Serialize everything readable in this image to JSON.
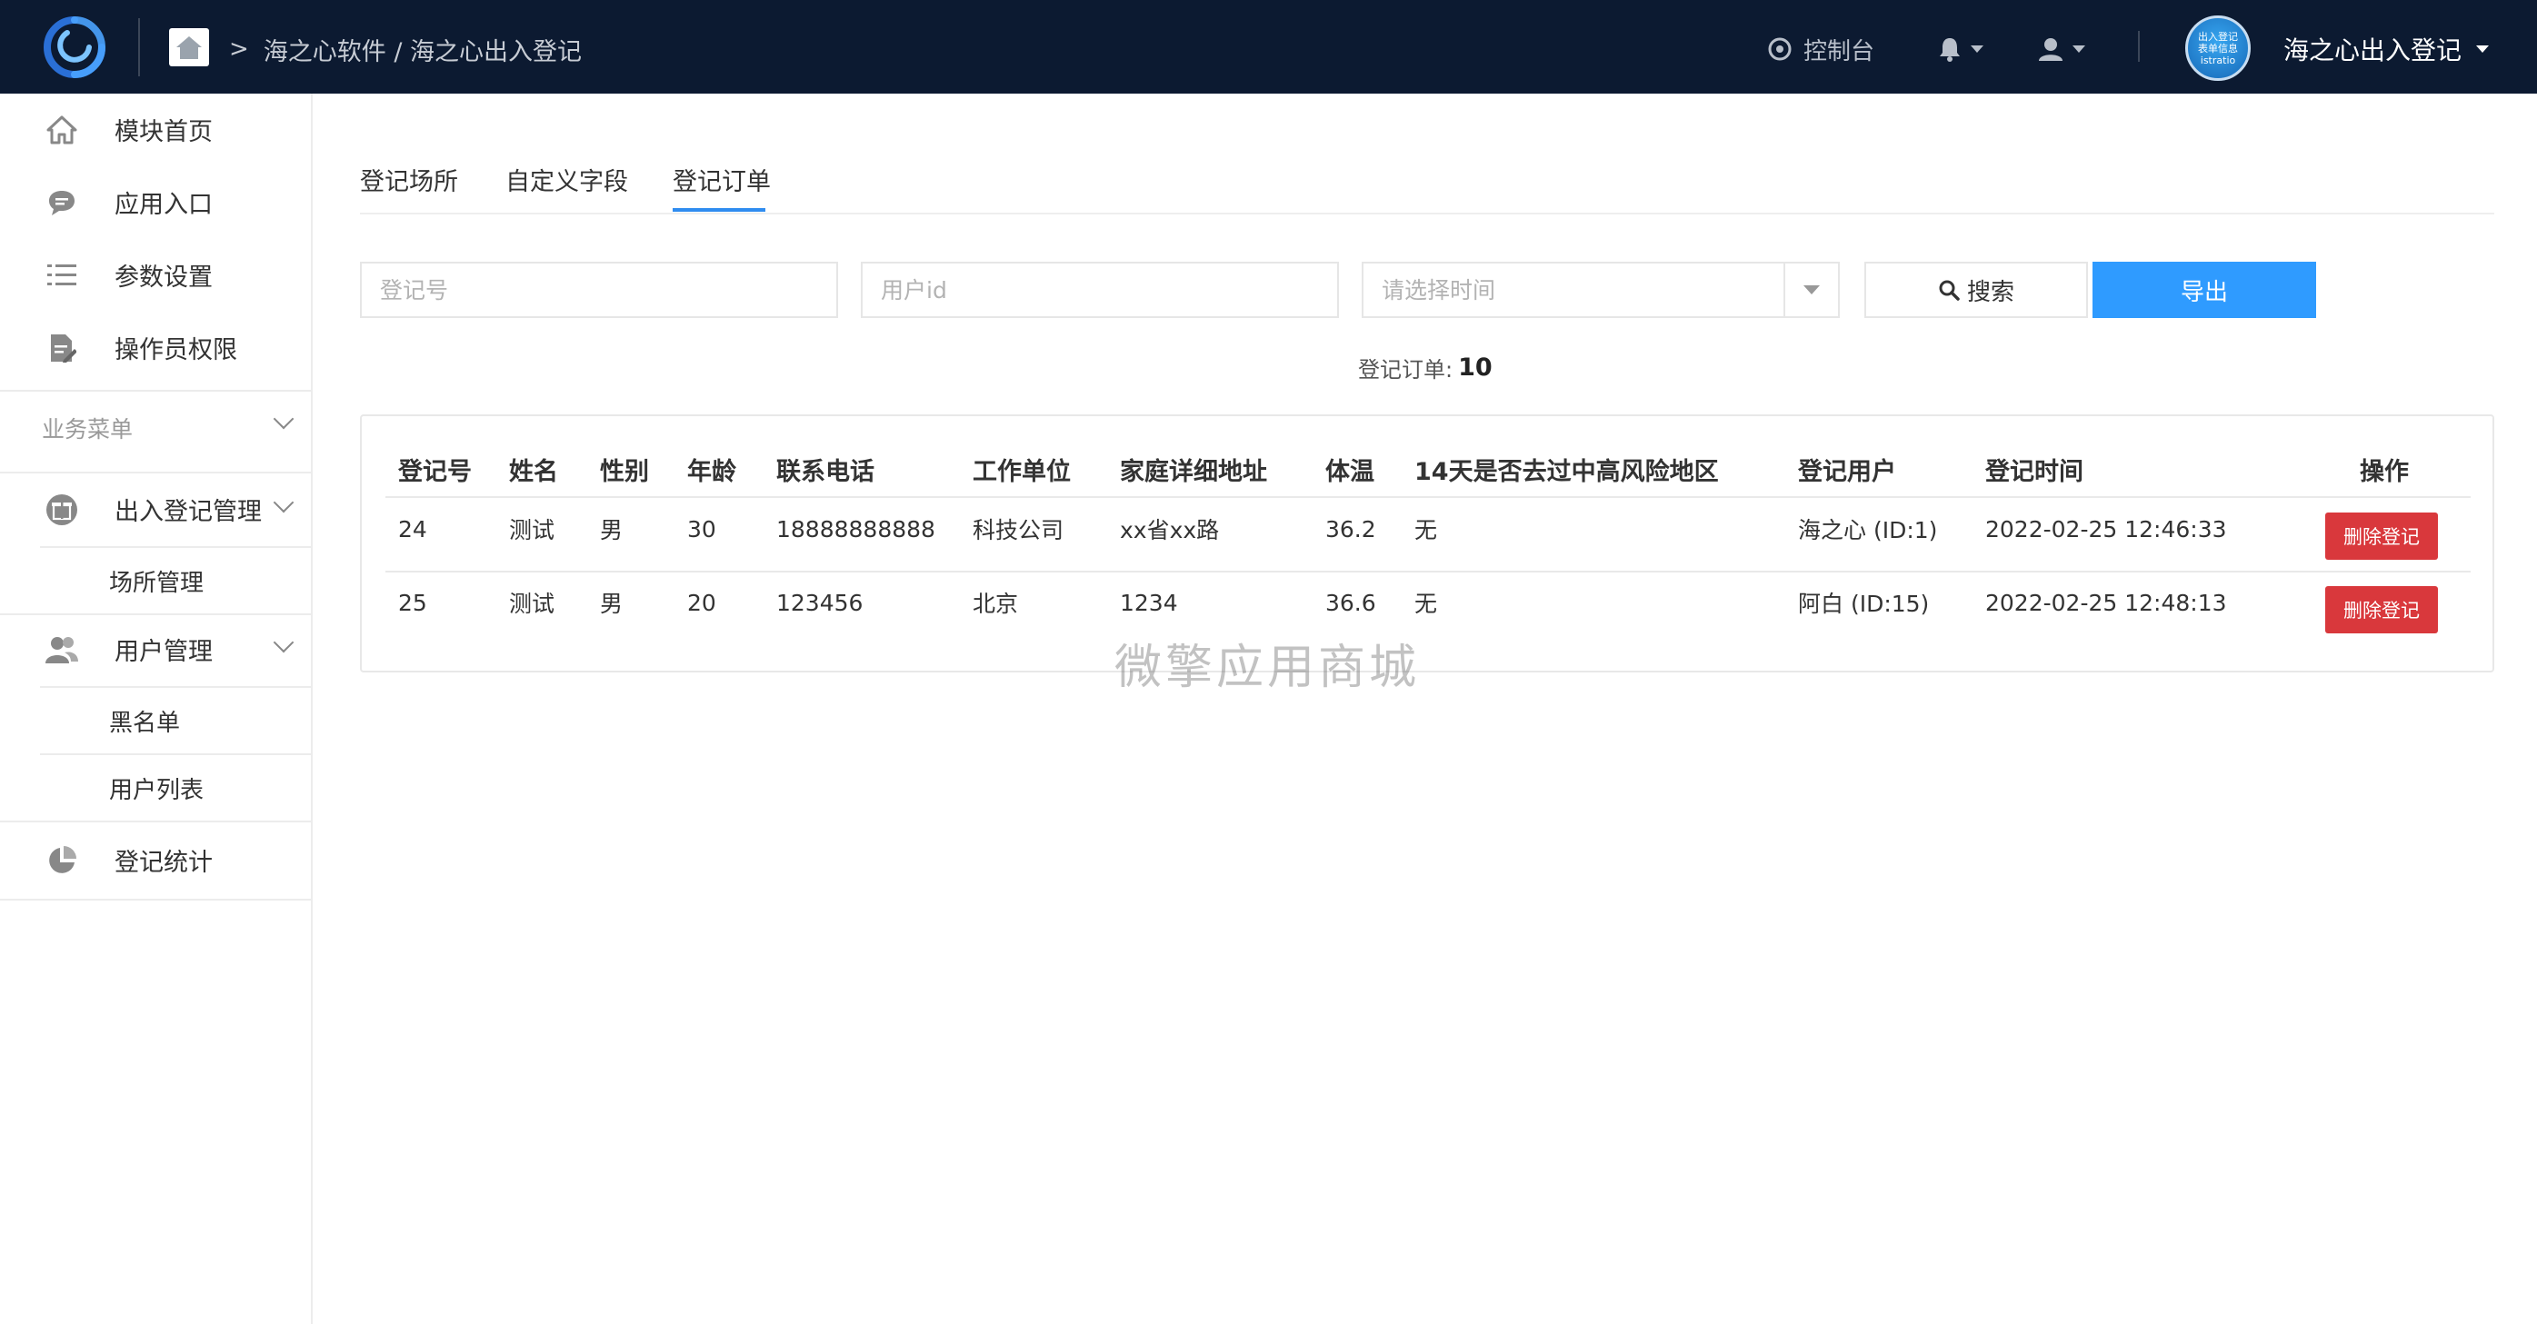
{
  "header": {
    "breadcrumb": "海之心软件 / 海之心出入登记",
    "console_label": "控制台",
    "user_name": "海之心出入登记",
    "avatar_text": [
      "出入登记",
      "表单信息",
      "istratio"
    ]
  },
  "sidebar": {
    "items": [
      {
        "label": "模块首页",
        "icon": "home-icon"
      },
      {
        "label": "应用入口",
        "icon": "chat-icon"
      },
      {
        "label": "参数设置",
        "icon": "list-icon"
      },
      {
        "label": "操作员权限",
        "icon": "doc-edit-icon"
      }
    ],
    "section_label": "业务菜单",
    "groups": [
      {
        "label": "出入登记管理",
        "icon": "gift-icon",
        "children": [
          "场所管理"
        ]
      },
      {
        "label": "用户管理",
        "icon": "users-icon",
        "children": [
          "黑名单",
          "用户列表"
        ]
      }
    ],
    "stats": {
      "label": "登记统计",
      "icon": "pie-chart-icon"
    }
  },
  "tabs": [
    "登记场所",
    "自定义字段",
    "登记订单"
  ],
  "active_tab": "登记订单",
  "filters": {
    "reg_no_placeholder": "登记号",
    "user_id_placeholder": "用户id",
    "time_placeholder": "请选择时间",
    "search_label": "搜索",
    "export_label": "导出"
  },
  "summary": {
    "label": "登记订单:",
    "count": "10"
  },
  "table": {
    "headers": [
      "登记号",
      "姓名",
      "性别",
      "年龄",
      "联系电话",
      "工作单位",
      "家庭详细地址",
      "体温",
      "14天是否去过中高风险地区",
      "登记用户",
      "登记时间",
      "操作"
    ],
    "rows": [
      [
        "24",
        "测试",
        "男",
        "30",
        "18888888888",
        "科技公司",
        "xx省xx路",
        "36.2",
        "无",
        "海之心 (ID:1)",
        "2022-02-25 12:46:33"
      ],
      [
        "25",
        "测试",
        "男",
        "20",
        "123456",
        "北京",
        "1234",
        "36.6",
        "无",
        "阿白 (ID:15)",
        "2022-02-25 12:48:13"
      ]
    ],
    "delete_label": "删除登记"
  },
  "watermark": "微擎应用商城",
  "colors": {
    "topbar": "#0c1a31",
    "accent": "#2f9bff",
    "danger": "#d9383c"
  }
}
